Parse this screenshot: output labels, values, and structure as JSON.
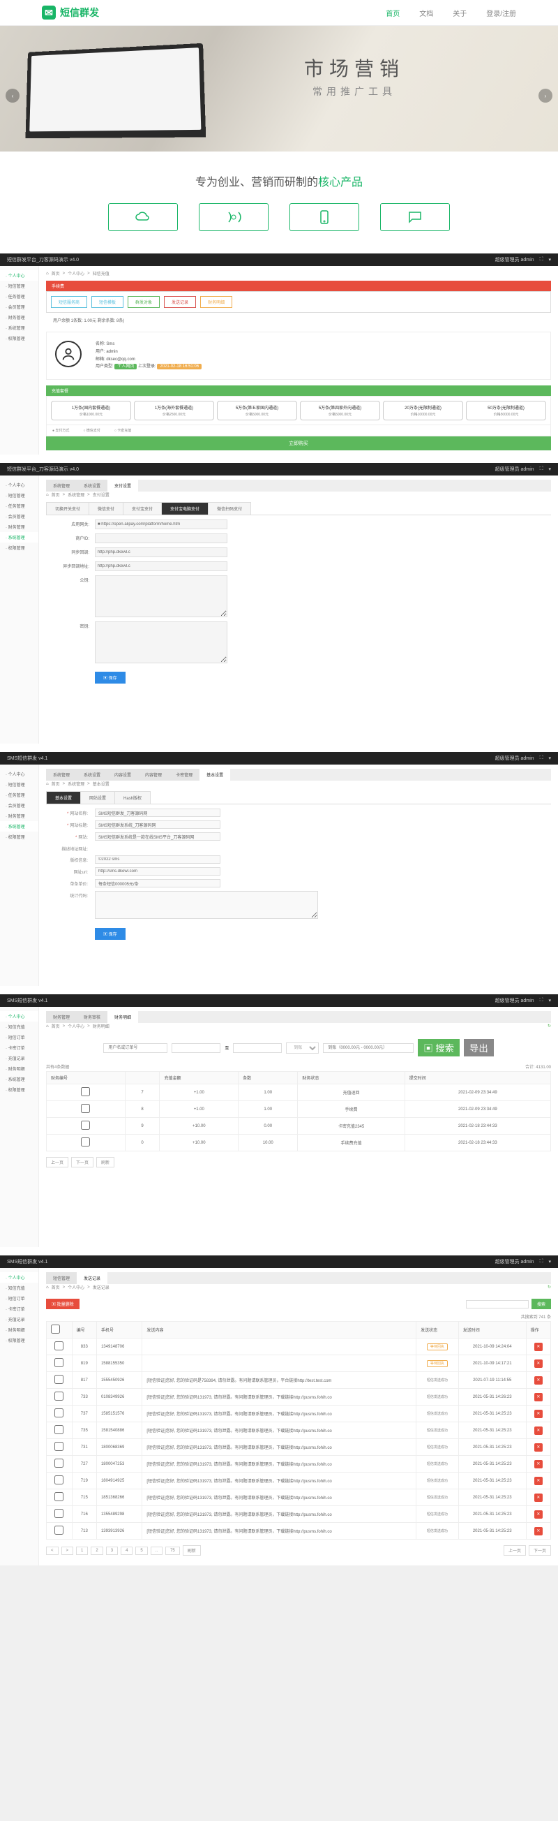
{
  "hero": {
    "logo": "短信群发",
    "nav": [
      "首页",
      "文档",
      "关于",
      "登录/注册"
    ],
    "title": "市场营销",
    "subtitle": "常用推广工具",
    "tagline_pre": "专为创业、营销而研制的",
    "tagline_accent": "核心产品"
  },
  "panel1": {
    "app_title": "短信群发平台_刀客源码演示 v4.0",
    "user_label": "超级管理员 admin",
    "side": [
      "· 个人中心",
      "· 短信管理",
      "· 任务管理",
      "· 会员管理",
      "· 财务管理",
      "· 系统管理",
      "· 权限管理"
    ],
    "crumbs": [
      "首页",
      "个人中心",
      "知信充值"
    ],
    "alert": "手续费",
    "tabs": [
      "短信服务商",
      "短信模板",
      "群发对象",
      "发送记录",
      "财务明细"
    ],
    "balance_line": "用户余额 1条数: 1.00元 剩余条数: 8条)",
    "info": {
      "name_l": "名称: Sms",
      "user_l": "用户: admin",
      "email_l": "邮箱: dksec@qq.com",
      "type_l": "用户类型:",
      "badge1": "个人网页",
      "last_l": "上次登录:",
      "badge2": "2021-02-18 16:51:06"
    },
    "pkg_head": "充值套餐",
    "pkgs": [
      {
        "t": "1万条(国内套餐通道)",
        "p": "价格1000.00元"
      },
      {
        "t": "1万条(海外套餐通道)",
        "p": "价格2500.00元"
      },
      {
        "t": "5万条(第五家国内通道)",
        "p": "价格5000.00元"
      },
      {
        "t": "5万条(第四家外向通道)",
        "p": "价格5000.00元"
      },
      {
        "t": "20万条(无限制通道)",
        "p": "价格10000.00元"
      },
      {
        "t": "50万条(无限制通道)",
        "p": "价格50000.00元"
      }
    ],
    "foot": [
      "● 支付方式",
      "○ 微信支付",
      "○ 卡密充值"
    ],
    "buy": "立即购买"
  },
  "panel2": {
    "app_title": "短信群发平台_刀客源码演示 v4.0",
    "user_label": "超级管理员 admin",
    "side": [
      "· 个人中心",
      "· 短信管理",
      "· 任务管理",
      "· 会员管理",
      "· 财务管理",
      "· 系统管理",
      "· 权限管理"
    ],
    "top_tabs": [
      "系统管理",
      "系统设置",
      "支付设置"
    ],
    "crumbs": [
      "首页",
      "系统管理",
      "支付设置"
    ],
    "subtabs": [
      "切换开关支付",
      "微信支付",
      "支付宝支付",
      "支付宝电脑支付",
      "微信扫码支付"
    ],
    "rows": [
      {
        "l": "应用网关:",
        "v": "■ https://open.alipay.com/platform/home.htm"
      },
      {
        "l": "商户ID:",
        "v": ""
      },
      {
        "l": "同步回调:",
        "v": "http://php.dkewl.c"
      },
      {
        "l": "异步回调地址:",
        "v": "http://php.dkewl.c"
      },
      {
        "l": "公钥:",
        "v": ""
      },
      {
        "l": "密钥:",
        "v": ""
      }
    ],
    "save": "▣ 保存"
  },
  "panel3": {
    "app_title": "SMS短信群发 v4.1",
    "user_label": "超级管理员 admin",
    "side": [
      "· 个人中心",
      "· 短信管理",
      "· 任务管理",
      "· 会员管理",
      "· 财务管理",
      "· 系统管理",
      "· 权限管理"
    ],
    "top_tabs": [
      "系统管理",
      "系统设置",
      "内容设置",
      "内容管理",
      "卡密管理",
      "基本设置"
    ],
    "crumbs": [
      "首页",
      "系统管理",
      "基本设置"
    ],
    "subtabs": [
      "基本设置",
      "网站设置",
      "Hash版权"
    ],
    "rows": [
      {
        "l": "网站名称:",
        "v": "SMS短信群发_刀客源码网"
      },
      {
        "l": "网站标题:",
        "v": "SMS短信群发系统_刀客源码网"
      },
      {
        "l": "网站:",
        "v": "SMS短信群发系统是一款在线SMS平台_刀客源码网"
      },
      {
        "l": "描述地址网址:",
        "v": ""
      },
      {
        "l": "版权信息:",
        "v": "©2022 sms"
      },
      {
        "l": "网址url:",
        "v": "http://sms.dkewl.com"
      },
      {
        "l": "单条单价:",
        "v": "每条短信000005元/条"
      },
      {
        "l": "统计代码:",
        "v": ""
      }
    ],
    "save": "▣ 保存"
  },
  "panel4": {
    "app_title": "SMS短信群发 v4.1",
    "user_label": "超级管理员 admin",
    "side": [
      "· 个人中心",
      "· 知信充值",
      "· 短信订单",
      "· 卡密订单",
      "· 充值记录",
      "· 财务明细",
      "· 系统管理",
      "· 权限管理"
    ],
    "top_tabs": [
      "财务管理",
      "财务审核",
      "财务明细"
    ],
    "crumbs": [
      "首页",
      "个人中心",
      "财务明细"
    ],
    "filters": {
      "kw": "用户名或订单号",
      "time": "至",
      "amt1": "到账",
      "amt2": "到账（0000.00元 - 0000.00元）",
      "search": "▣ 搜索",
      "export": "导出"
    },
    "found": "共有4条数据",
    "total": "合计: 4131.00",
    "cols": [
      "财务编号",
      "",
      "充值金额",
      "条数",
      "财务状态",
      "提交时间"
    ],
    "rows": [
      {
        "id": "7",
        "amt": "+1.00",
        "cnt": "1.00",
        "st": "充值退回",
        "time": "2021-02-09 23:34:49"
      },
      {
        "id": "8",
        "amt": "+1.00",
        "cnt": "1.00",
        "st": "手续费",
        "time": "2021-02-09 23:34:49"
      },
      {
        "id": "9",
        "amt": "+10.00",
        "cnt": "0.00",
        "st": "卡密充值2345",
        "time": "2021-02-18 23:44:33"
      },
      {
        "id": "0",
        "amt": "+10.00",
        "cnt": "10.00",
        "st": "手续费充值",
        "time": "2021-02-18 23:44:33"
      }
    ],
    "pager": [
      "上一页",
      "下一页",
      "刷新"
    ]
  },
  "panel5": {
    "app_title": "SMS短信群发 v4.1",
    "user_label": "超级管理员 admin",
    "side": [
      "· 个人中心",
      "· 知信充值",
      "· 短信订单",
      "· 卡密订单",
      "· 充值记录",
      "· 财务明细",
      "· 权限管理"
    ],
    "top_tabs": [
      "短信管理",
      "发送记录"
    ],
    "crumbs": [
      "首页",
      "个人中心",
      "发送记录"
    ],
    "btn_del": "▣ 批量删除",
    "search": "搜索",
    "found": "共搜索到 741 条",
    "cols": [
      "",
      "编号",
      "手机号",
      "发送内容",
      "发送状态",
      "发送时间",
      "操作"
    ],
    "rows": [
      {
        "id": "833",
        "ph": "1349148706",
        "ct": "",
        "st": "等待回执",
        "time": "2021-10-09 14:24:04"
      },
      {
        "id": "819",
        "ph": "1588155350",
        "ct": "",
        "st": "等待回执",
        "time": "2021-10-09 14:17:21"
      },
      {
        "id": "817",
        "ph": "1555450926",
        "ct": "[短信验证]您好, 您的验证码是758394, 请勿泄露。有问题请联系管理员，平台链接http://test.test.com",
        "st": "短信发送成功",
        "time": "2021-07-19 11:14:55"
      },
      {
        "id": "733",
        "ph": "0108349926",
        "ct": "[短信验证]您好, 您的验证码131973, 请勿泄露。有问题请联系管理员，下载链接http://pusms.fohih.co",
        "st": "短信发送成功",
        "time": "2021-05-31 14:26:23"
      },
      {
        "id": "737",
        "ph": "1585151576",
        "ct": "[短信验证]您好, 您的验证码131973, 请勿泄露。有问题请联系管理员，下载链接http://pusms.fohih.co",
        "st": "短信发送成功",
        "time": "2021-05-31 14:25:23"
      },
      {
        "id": "735",
        "ph": "1581540886",
        "ct": "[短信验证]您好, 您的验证码131973, 请勿泄露。有问题请联系管理员，下载链接http://pusms.fohih.co",
        "st": "短信发送成功",
        "time": "2021-05-31 14:25:23"
      },
      {
        "id": "731",
        "ph": "1800068369",
        "ct": "[短信验证]您好, 您的验证码131973, 请勿泄露。有问题请联系管理员，下载链接http://pusms.fohih.co",
        "st": "短信发送成功",
        "time": "2021-05-31 14:25:23"
      },
      {
        "id": "727",
        "ph": "1800047253",
        "ct": "[短信验证]您好, 您的验证码131973, 请勿泄露。有问题请联系管理员，下载链接http://pusms.fohih.co",
        "st": "短信发送成功",
        "time": "2021-05-31 14:25:23"
      },
      {
        "id": "719",
        "ph": "1804914925",
        "ct": "[短信验证]您好, 您的验证码131973, 请勿泄露。有问题请联系管理员，下载链接http://pusms.fohih.co",
        "st": "短信发送成功",
        "time": "2021-05-31 14:25:23"
      },
      {
        "id": "715",
        "ph": "1851368266",
        "ct": "[短信验证]您好, 您的验证码131973, 请勿泄露。有问题请联系管理员，下载链接http://pusms.fohih.co",
        "st": "短信发送成功",
        "time": "2021-05-31 14:25:23"
      },
      {
        "id": "716",
        "ph": "1355489298",
        "ct": "[短信验证]您好, 您的验证码131973, 请勿泄露。有问题请联系管理员，下载链接http://pusms.fohih.co",
        "st": "短信发送成功",
        "time": "2021-05-31 14:25:23"
      },
      {
        "id": "713",
        "ph": "1393913926",
        "ct": "[短信验证]您好, 您的验证码131973, 请勿泄露。有问题请联系管理员，下载链接http://pusms.fohih.co",
        "st": "短信发送成功",
        "time": "2021-05-31 14:25:23"
      }
    ],
    "pager": [
      "<",
      ">",
      "1",
      "2",
      "3",
      "4",
      "5",
      "..",
      "75",
      "刷新"
    ],
    "pager_r": [
      "上一页",
      "下一页"
    ]
  }
}
